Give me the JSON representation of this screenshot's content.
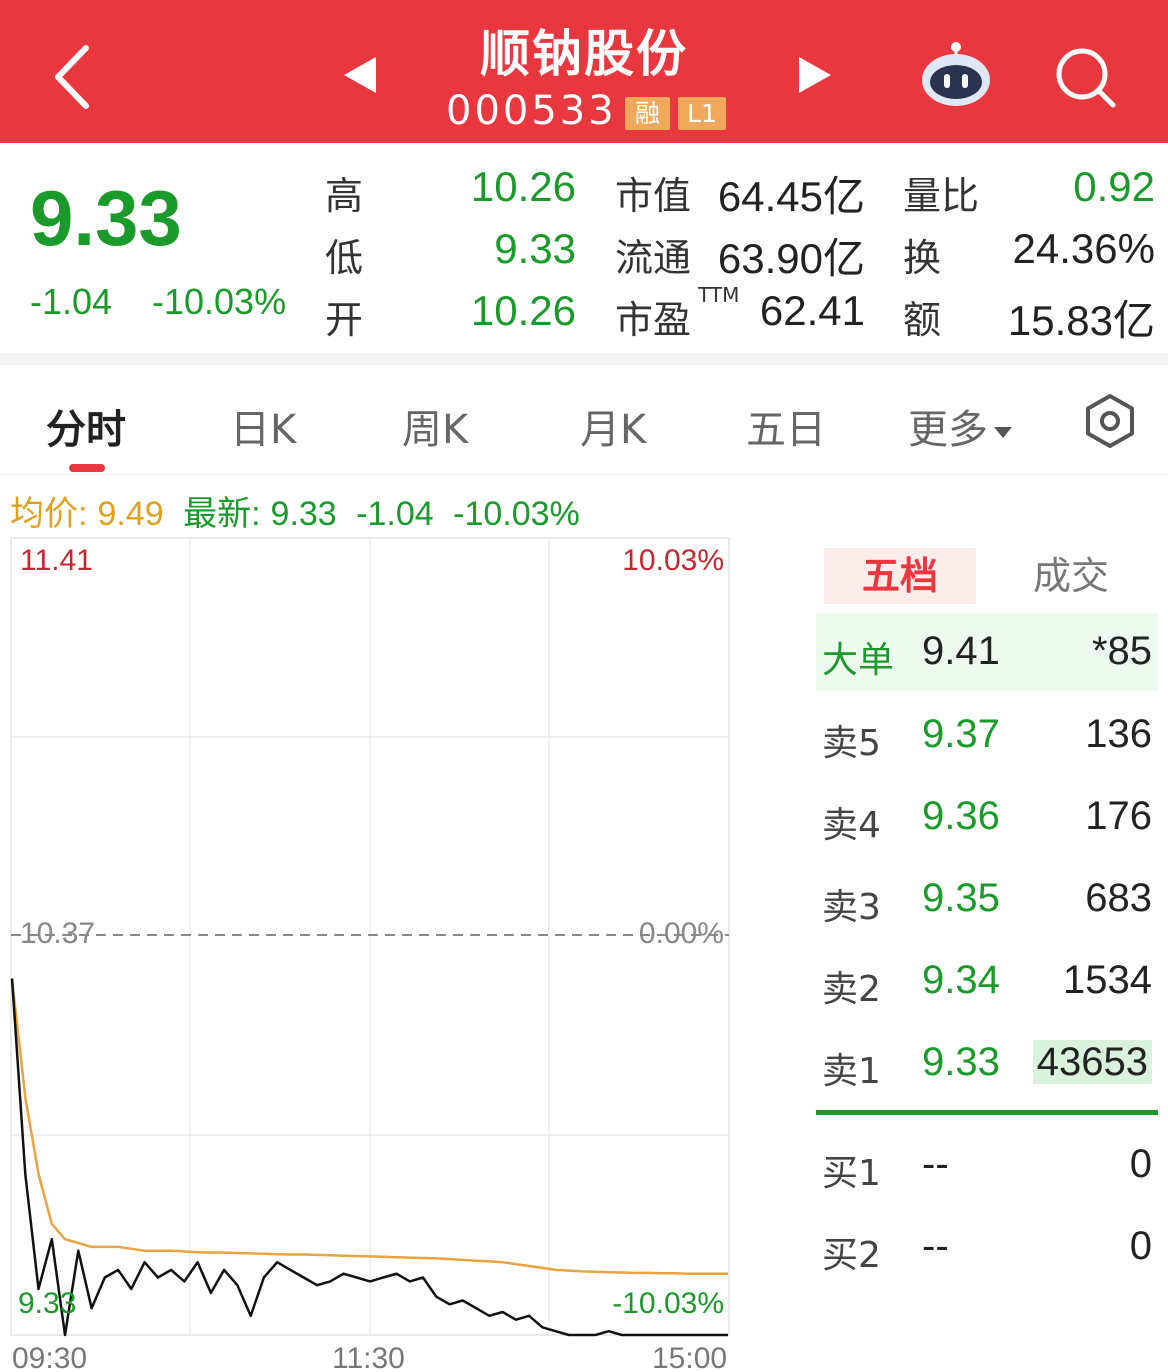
{
  "header": {
    "stock_name": "顺钠股份",
    "stock_code": "000533",
    "badge_margin": "融",
    "badge_level": "L1"
  },
  "quote": {
    "price": "9.33",
    "change": "-1.04",
    "change_pct": "-10.03%",
    "high_label": "高",
    "high": "10.26",
    "low_label": "低",
    "low": "9.33",
    "open_label": "开",
    "open": "10.26",
    "mktcap_label": "市值",
    "mktcap": "64.45亿",
    "float_label": "流通",
    "float": "63.90亿",
    "pe_label": "市盈",
    "pe_sup": "TTM",
    "pe": "62.41",
    "volratio_label": "量比",
    "volratio": "0.92",
    "turnover_label": "换",
    "turnover": "24.36%",
    "amount_label": "额",
    "amount": "15.83亿"
  },
  "tabs": [
    {
      "label": "分时",
      "active": true
    },
    {
      "label": "日K"
    },
    {
      "label": "周K"
    },
    {
      "label": "月K"
    },
    {
      "label": "五日"
    },
    {
      "label": "更多"
    }
  ],
  "info_bar": {
    "avg_label": "均价:",
    "avg": "9.49",
    "latest_label": "最新:",
    "latest": "9.33",
    "change": "-1.04",
    "change_pct": "-10.03%"
  },
  "chart_data": {
    "type": "line",
    "y_top_price": "11.41",
    "y_mid_price": "10.37",
    "y_bottom_price": "9.33",
    "y_top_pct": "10.03%",
    "y_mid_pct": "0.00%",
    "y_bottom_pct": "-10.03%",
    "ylim": [
      9.33,
      11.41
    ],
    "x_labels": [
      "09:30",
      "11:30",
      "15:00"
    ],
    "series": [
      {
        "name": "最新",
        "color": "#111111",
        "values": [
          10.26,
          9.75,
          9.45,
          9.58,
          9.33,
          9.55,
          9.4,
          9.48,
          9.5,
          9.45,
          9.52,
          9.48,
          9.5,
          9.47,
          9.52,
          9.44,
          9.5,
          9.46,
          9.38,
          9.48,
          9.52,
          9.5,
          9.48,
          9.46,
          9.47,
          9.49,
          9.48,
          9.47,
          9.48,
          9.49,
          9.47,
          9.48,
          9.43,
          9.41,
          9.42,
          9.4,
          9.38,
          9.39,
          9.37,
          9.38,
          9.35,
          9.34,
          9.33,
          9.33,
          9.33,
          9.34,
          9.33,
          9.33,
          9.33,
          9.33,
          9.33,
          9.33,
          9.33,
          9.33,
          9.33
        ]
      },
      {
        "name": "均价",
        "color": "#e8a440",
        "values": [
          10.26,
          9.95,
          9.75,
          9.62,
          9.58,
          9.57,
          9.56,
          9.56,
          9.56,
          9.555,
          9.55,
          9.55,
          9.55,
          9.548,
          9.546,
          9.545,
          9.545,
          9.544,
          9.543,
          9.542,
          9.541,
          9.54,
          9.54,
          9.539,
          9.538,
          9.537,
          9.536,
          9.535,
          9.534,
          9.533,
          9.532,
          9.531,
          9.53,
          9.528,
          9.526,
          9.524,
          9.522,
          9.52,
          9.515,
          9.51,
          9.505,
          9.5,
          9.498,
          9.496,
          9.495,
          9.494,
          9.493,
          9.492,
          9.492,
          9.491,
          9.491,
          9.49,
          9.49,
          9.49,
          9.49
        ]
      }
    ]
  },
  "order_book": {
    "tab_active": "五档",
    "tab_trades": "成交",
    "big_order": {
      "label": "大单",
      "price": "9.41",
      "volume": "*85"
    },
    "asks": [
      {
        "label": "卖5",
        "price": "9.37",
        "volume": "136"
      },
      {
        "label": "卖4",
        "price": "9.36",
        "volume": "176"
      },
      {
        "label": "卖3",
        "price": "9.35",
        "volume": "683"
      },
      {
        "label": "卖2",
        "price": "9.34",
        "volume": "1534"
      },
      {
        "label": "卖1",
        "price": "9.33",
        "volume": "43653"
      }
    ],
    "bids": [
      {
        "label": "买1",
        "price": "--",
        "volume": "0"
      },
      {
        "label": "买2",
        "price": "--",
        "volume": "0"
      }
    ]
  },
  "colors": {
    "header_bg": "#e8373e",
    "down_green": "#1a9a2a",
    "avg_gold": "#e0a020",
    "up_red": "#e8373e"
  }
}
